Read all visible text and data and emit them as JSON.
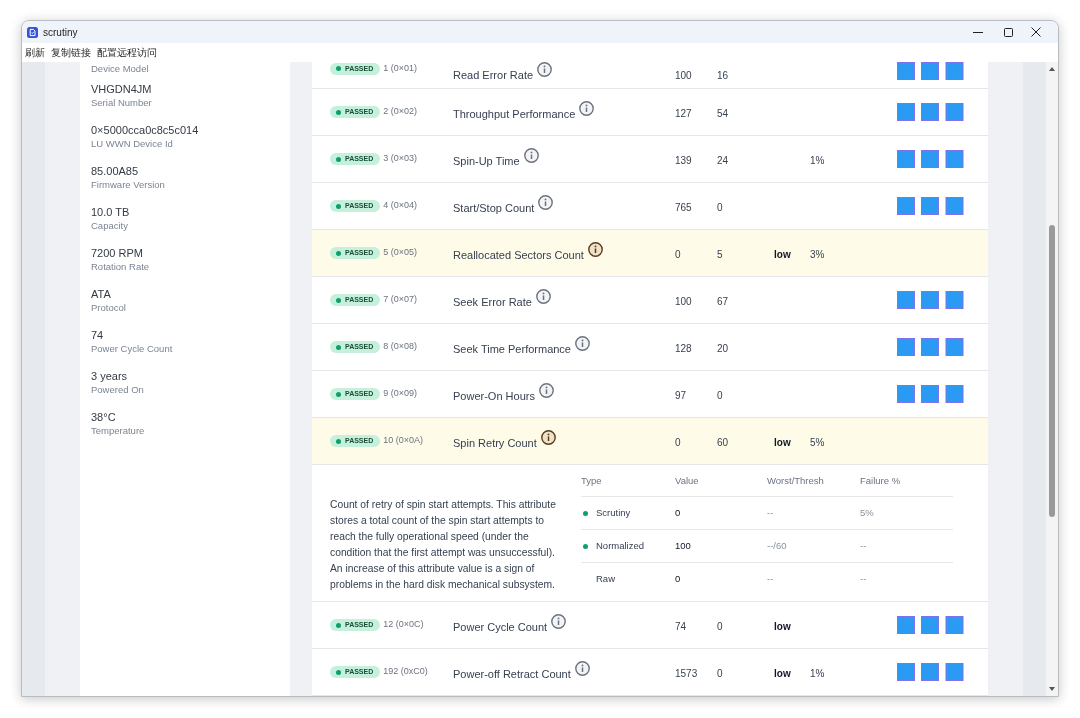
{
  "window": {
    "title": "scrutiny"
  },
  "menu": [
    {
      "label": "刷新"
    },
    {
      "label": "复制链接"
    },
    {
      "label": "配置远程访问"
    }
  ],
  "device_info": [
    {
      "label": "Device Model"
    },
    {
      "value": "VHGDN4JM",
      "label": "Serial Number"
    },
    {
      "value": "0×5000cca0c8c5c014",
      "label": "LU WWN Device Id"
    },
    {
      "value": "85.00A85",
      "label": "Firmware Version"
    },
    {
      "value": "10.0 TB",
      "label": "Capacity"
    },
    {
      "value": "7200 RPM",
      "label": "Rotation Rate"
    },
    {
      "value": "ATA",
      "label": "Protocol"
    },
    {
      "value": "74",
      "label": "Power Cycle Count"
    },
    {
      "value": "3 years",
      "label": "Powered On"
    },
    {
      "value": "38°C",
      "label": "Temperature"
    }
  ],
  "attributes": [
    {
      "status": "PASSED",
      "id": "1 (0×01)",
      "name": "Read Error Rate",
      "column_4": "100",
      "column_5": "16",
      "highlighted": false
    },
    {
      "status": "PASSED",
      "id": "2 (0×02)",
      "name": "Throughput Performance",
      "column_4": "127",
      "column_5": "54",
      "highlighted": false
    },
    {
      "status": "PASSED",
      "id": "3 (0×03)",
      "name": "Spin-Up Time",
      "column_4": "139",
      "column_5": "24",
      "column_7": "1%",
      "highlighted": false
    },
    {
      "status": "PASSED",
      "id": "4 (0×04)",
      "name": "Start/Stop Count",
      "column_4": "765",
      "column_5": "0",
      "highlighted": false
    },
    {
      "status": "PASSED",
      "id": "5 (0×05)",
      "name": "Reallocated Sectors Count",
      "column_4": "0",
      "column_5": "5",
      "column_6": "low",
      "column_7": "3%",
      "highlighted": true
    },
    {
      "status": "PASSED",
      "id": "7 (0×07)",
      "name": "Seek Error Rate",
      "column_4": "100",
      "column_5": "67",
      "highlighted": false
    },
    {
      "status": "PASSED",
      "id": "8 (0×08)",
      "name": "Seek Time Performance",
      "column_4": "128",
      "column_5": "20",
      "highlighted": false
    },
    {
      "status": "PASSED",
      "id": "9 (0×09)",
      "name": "Power-On Hours",
      "column_4": "97",
      "column_5": "0",
      "highlighted": false
    },
    {
      "status": "PASSED",
      "id": "10 (0×0A)",
      "name": "Spin Retry Count",
      "column_4": "0",
      "column_5": "60",
      "column_6": "low",
      "column_7": "5%",
      "highlighted": true,
      "details": {
        "description": "Count of retry of spin start attempts. This attribute stores a total count of the spin start attempts to reach the fully operational speed (under the condition that the first attempt was unsuccessful). An increase of this attribute value is a sign of problems in the hard disk mechanical subsystem.",
        "columns": [
          "Type",
          "Value",
          "Worst/Thresh",
          "Failure %"
        ],
        "rows": [
          {
            "type": "Scrutiny",
            "status_dot": true,
            "value": "0",
            "worst_thresh": "--",
            "failure": "5%"
          },
          {
            "type": "Normalized",
            "status_dot": true,
            "value": "100",
            "worst_thresh": "--/60",
            "failure": "--"
          },
          {
            "type": "Raw",
            "status_dot": false,
            "value": "0",
            "worst_thresh": "--",
            "failure": "--"
          }
        ]
      }
    },
    {
      "status": "PASSED",
      "id": "12 (0×0C)",
      "name": "Power Cycle Count",
      "column_4": "74",
      "column_5": "0",
      "column_6": "low",
      "highlighted": false
    },
    {
      "status": "PASSED",
      "id": "192 (0xC0)",
      "name": "Power-off Retract Count",
      "column_4": "1573",
      "column_5": "0",
      "column_6": "low",
      "column_7": "1%",
      "highlighted": false
    }
  ]
}
